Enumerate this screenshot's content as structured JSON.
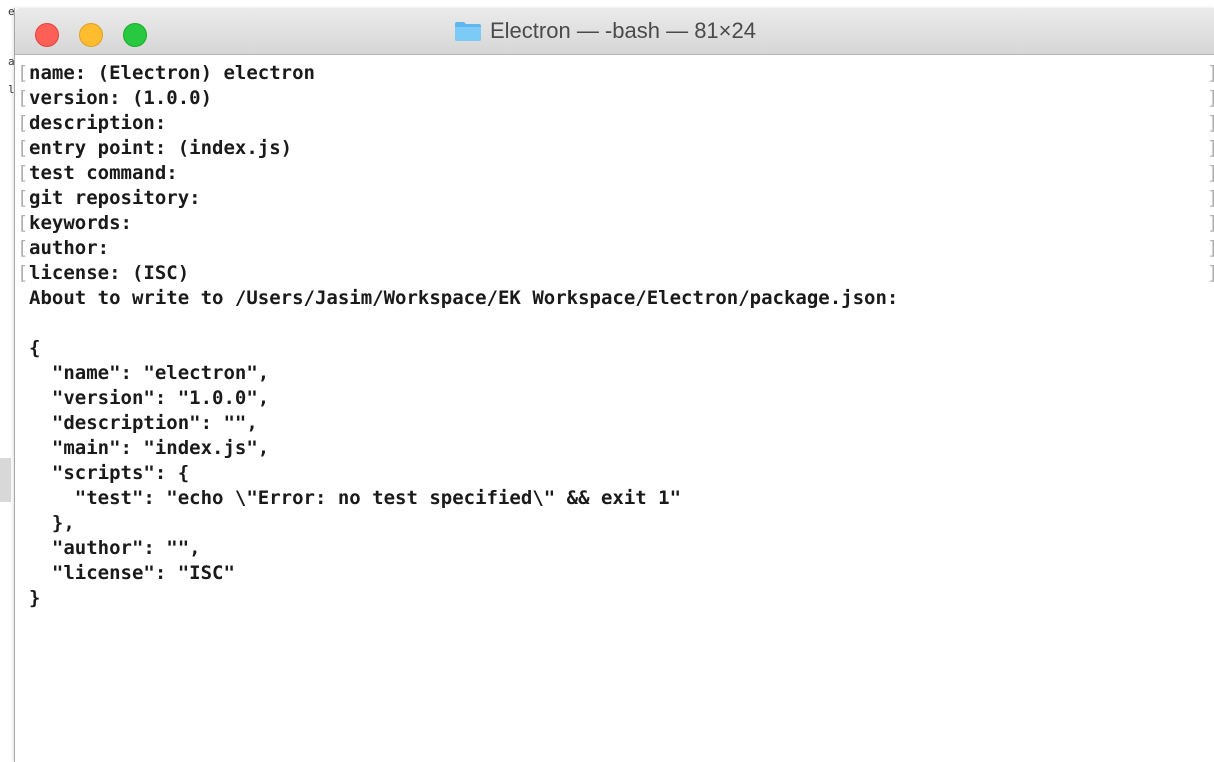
{
  "background_fragments": [
    "e",
    "a",
    "l"
  ],
  "window": {
    "title": "Electron — -bash — 81×24",
    "folder_color": "#6ec3f4",
    "traffic_lights": {
      "close": "#fe5f57",
      "minimize": "#febc2e",
      "maximize": "#28c840"
    }
  },
  "terminal": {
    "prompt_lines": [
      "name: (Electron) electron",
      "version: (1.0.0)",
      "description:",
      "entry point: (index.js)",
      "test command:",
      "git repository:",
      "keywords:",
      "author:",
      "license: (ISC)"
    ],
    "bracket_left": "[",
    "bracket_right": "]",
    "output_lines": [
      "About to write to /Users/Jasim/Workspace/EK Workspace/Electron/package.json:",
      "",
      "{",
      "  \"name\": \"electron\",",
      "  \"version\": \"1.0.0\",",
      "  \"description\": \"\",",
      "  \"main\": \"index.js\",",
      "  \"scripts\": {",
      "    \"test\": \"echo \\\"Error: no test specified\\\" && exit 1\"",
      "  },",
      "  \"author\": \"\",",
      "  \"license\": \"ISC\"",
      "}"
    ]
  }
}
